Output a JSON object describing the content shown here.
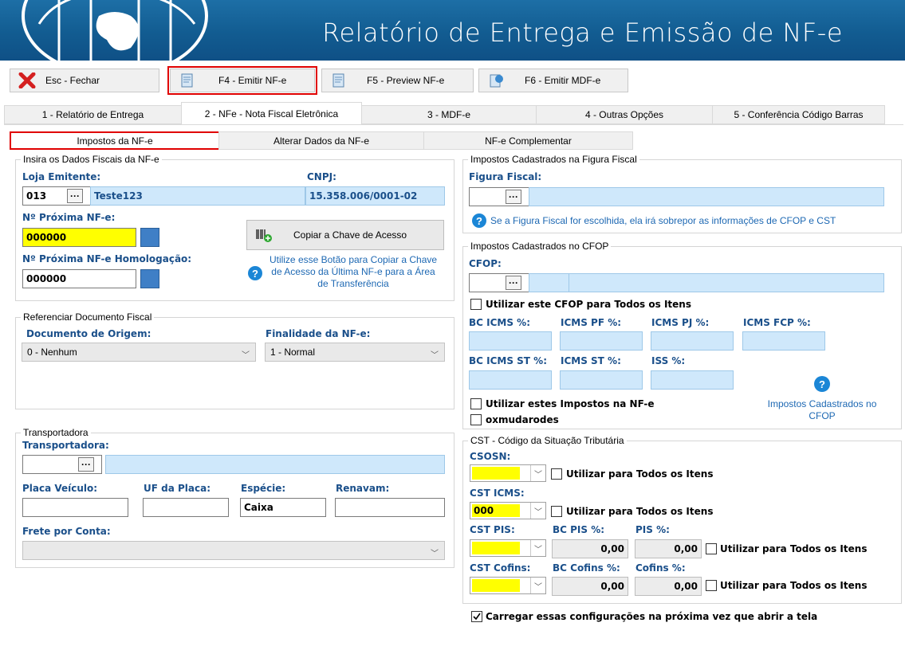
{
  "header": {
    "title": "Relatório de Entrega e Emissão de NF-e"
  },
  "toolbar": {
    "close": "Esc - Fechar",
    "emit": "F4 - Emitir NF-e",
    "preview": "F5 - Preview NF-e",
    "mdfe": "F6 - Emitir MDF-e"
  },
  "tabs": [
    "1 - Relatório de Entrega",
    "2 - NFe - Nota Fiscal Eletrônica",
    "3 - MDF-e",
    "4 - Outras Opções",
    "5 - Conferência Código Barras"
  ],
  "subtabs": [
    "Impostos da NF-e",
    "Alterar Dados da NF-e",
    "NF-e Complementar"
  ],
  "fiscal": {
    "group_title": "Insira os Dados Fiscais da NF-e",
    "loja_label": "Loja Emitente:",
    "loja_code": "013",
    "loja_name": "Teste123",
    "cnpj_label": "CNPJ:",
    "cnpj_value": "15.358.006/0001-02",
    "prox_label": "Nº Próxima NF-e:",
    "prox_value": "000000",
    "homolog_label": "Nº Próxima NF-e Homologação:",
    "homolog_value": "000000",
    "copy_button": "Copiar a Chave de Acesso",
    "copy_note": "Utilize esse Botão para Copiar a Chave de Acesso da Última NF-e para a Área de Transferência"
  },
  "referencia": {
    "group_title": "Referenciar Documento Fiscal",
    "origem_label": "Documento de Origem:",
    "origem_value": "0 - Nenhum",
    "finalidade_label": "Finalidade da NF-e:",
    "finalidade_value": "1 - Normal"
  },
  "transportadora": {
    "group_title": "Transportadora",
    "label": "Transportadora:",
    "placa_label": "Placa Veículo:",
    "uf_label": "UF da Placa:",
    "especie_label": "Espécie:",
    "especie_value": "Caixa",
    "renavam_label": "Renavam:",
    "frete_label": "Frete por Conta:"
  },
  "figura": {
    "group_title": "Impostos Cadastrados na Figura Fiscal",
    "label": "Figura Fiscal:",
    "note": "Se a Figura Fiscal for escolhida, ela irá sobrepor as informações de CFOP e CST"
  },
  "cfop": {
    "group_title": "Impostos Cadastrados no CFOP",
    "label": "CFOP:",
    "use_all": "Utilizar este CFOP para Todos os Itens",
    "bc_icms": "BC ICMS %:",
    "icms_pf": "ICMS PF %:",
    "icms_pj": "ICMS PJ %:",
    "icms_fcp": "ICMS FCP %:",
    "bc_icms_st": "BC ICMS ST %:",
    "icms_st": "ICMS ST %:",
    "iss": "ISS %:",
    "use_taxes": "Utilizar estes Impostos na NF-e",
    "oxmudarodes": "oxmudarodes",
    "help_note": "Impostos Cadastrados no CFOP"
  },
  "cst": {
    "group_title": "CST - Código da Situação Tributária",
    "csosn_label": "CSOSN:",
    "cst_icms_label": "CST ICMS:",
    "cst_icms_value": "000",
    "cst_pis_label": "CST PIS:",
    "bc_pis_label": "BC PIS %:",
    "pis_label": "PIS %:",
    "bc_pis_value": "0,00",
    "pis_value": "0,00",
    "cst_cofins_label": "CST Cofins:",
    "bc_cofins_label": "BC Cofins %:",
    "cofins_label": "Cofins %:",
    "bc_cofins_value": "0,00",
    "cofins_value": "0,00",
    "use_all": "Utilizar para Todos os Itens"
  },
  "footer": {
    "load_config": "Carregar essas configurações na próxima vez que abrir a tela"
  }
}
